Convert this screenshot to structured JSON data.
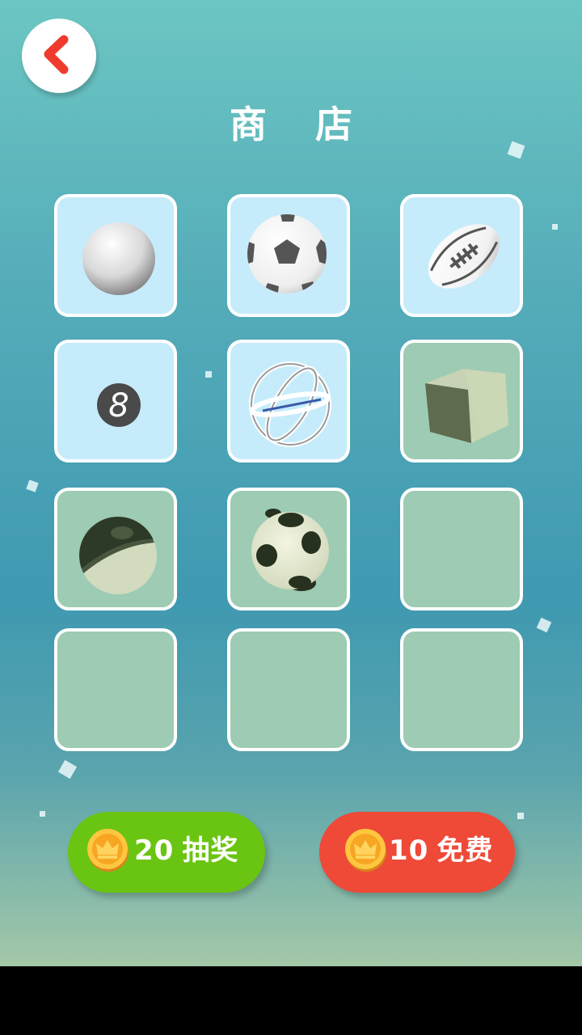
{
  "header": {
    "title": "商 店"
  },
  "shop": {
    "slots": [
      {
        "item": "white-ball",
        "owned": true
      },
      {
        "item": "soccer-ball",
        "owned": true
      },
      {
        "item": "rugby-ball",
        "owned": true
      },
      {
        "item": "eight-ball",
        "owned": true
      },
      {
        "item": "gyro-ring-ball",
        "owned": true
      },
      {
        "item": "cube",
        "owned": false
      },
      {
        "item": "half-dark-ball",
        "owned": false
      },
      {
        "item": "panda-ball",
        "owned": false
      },
      {
        "item": "empty",
        "owned": false
      },
      {
        "item": "empty",
        "owned": false
      },
      {
        "item": "empty",
        "owned": false
      },
      {
        "item": "empty",
        "owned": false
      }
    ]
  },
  "actions": {
    "lottery": {
      "cost": "20",
      "label": "抽奖",
      "color": "#6ac512",
      "icon": "gold-crown-coin-icon"
    },
    "free": {
      "cost": "10",
      "label": "免费",
      "color": "#ef4938",
      "icon": "gold-crown-coin-icon"
    }
  },
  "colors": {
    "accent_back": "#ef3b2d",
    "owned_slot": "#c6ecfb",
    "locked_slot": "#9dcbb3"
  }
}
